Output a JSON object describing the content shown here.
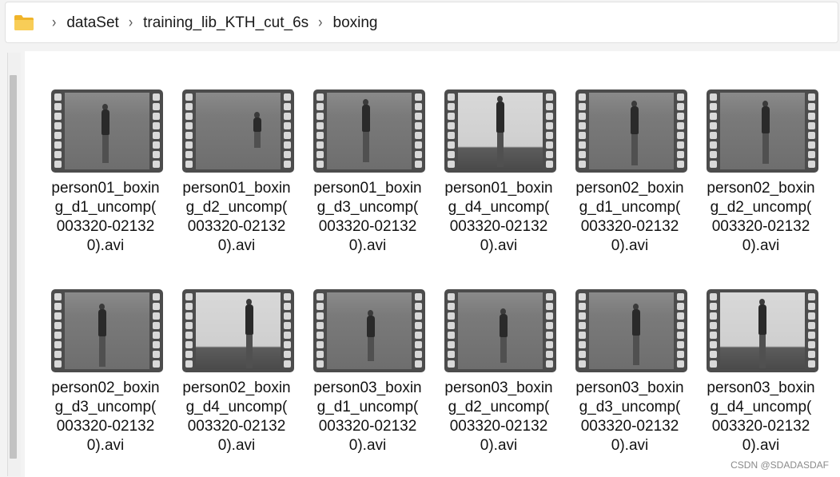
{
  "breadcrumb": {
    "items": [
      "dataSet",
      "training_lib_KTH_cut_6s",
      "boxing"
    ]
  },
  "files": [
    {
      "line1": "person01_boxin",
      "line2": "g_d1_uncomp(",
      "line3": "003320-02132",
      "line4": "0).avi",
      "bg": "grass"
    },
    {
      "line1": "person01_boxin",
      "line2": "g_d2_uncomp(",
      "line3": "003320-02132",
      "line4": "0).avi",
      "bg": "grass"
    },
    {
      "line1": "person01_boxin",
      "line2": "g_d3_uncomp(",
      "line3": "003320-02132",
      "line4": "0).avi",
      "bg": "grass"
    },
    {
      "line1": "person01_boxin",
      "line2": "g_d4_uncomp(",
      "line3": "003320-02132",
      "line4": "0).avi",
      "bg": "wall"
    },
    {
      "line1": "person02_boxin",
      "line2": "g_d1_uncomp(",
      "line3": "003320-02132",
      "line4": "0).avi",
      "bg": "grass"
    },
    {
      "line1": "person02_boxin",
      "line2": "g_d2_uncomp(",
      "line3": "003320-02132",
      "line4": "0).avi",
      "bg": "grass"
    },
    {
      "line1": "person02_boxin",
      "line2": "g_d3_uncomp(",
      "line3": "003320-02132",
      "line4": "0).avi",
      "bg": "grass"
    },
    {
      "line1": "person02_boxin",
      "line2": "g_d4_uncomp(",
      "line3": "003320-02132",
      "line4": "0).avi",
      "bg": "wall"
    },
    {
      "line1": "person03_boxin",
      "line2": "g_d1_uncomp(",
      "line3": "003320-02132",
      "line4": "0).avi",
      "bg": "grass"
    },
    {
      "line1": "person03_boxin",
      "line2": "g_d2_uncomp(",
      "line3": "003320-02132",
      "line4": "0).avi",
      "bg": "grass"
    },
    {
      "line1": "person03_boxin",
      "line2": "g_d3_uncomp(",
      "line3": "003320-02132",
      "line4": "0).avi",
      "bg": "grass"
    },
    {
      "line1": "person03_boxin",
      "line2": "g_d4_uncomp(",
      "line3": "003320-02132",
      "line4": "0).avi",
      "bg": "wall"
    }
  ],
  "watermark": "CSDN @SDADASDAF",
  "colors": {
    "folder": "#f5c242",
    "film": "#4c4c4c"
  },
  "icons": {
    "folder": "folder-icon",
    "chevron": "chevron-right-icon",
    "video": "video-thumbnail-icon"
  }
}
